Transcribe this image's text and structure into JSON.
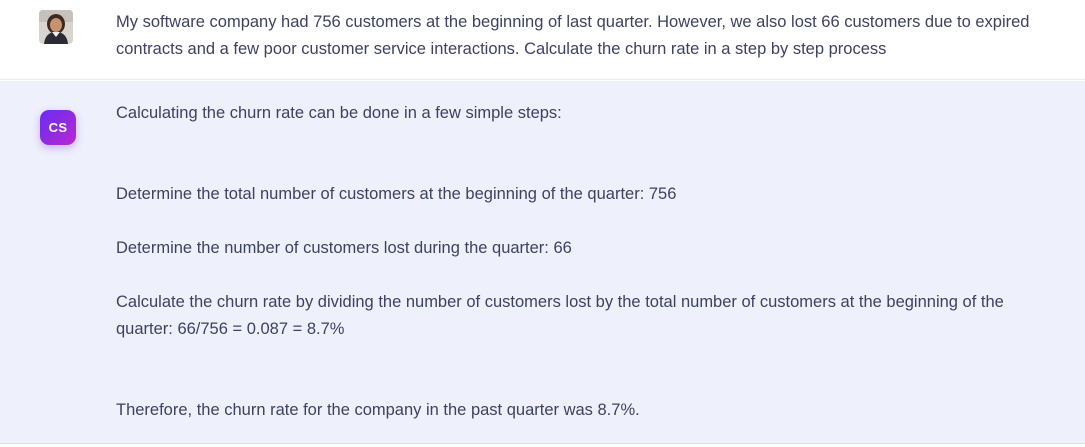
{
  "user_message": {
    "avatar_icon": "user-photo-avatar",
    "text": "My software company had 756 customers at the beginning of last quarter. However, we also lost 66 customers due to expired contracts and a few poor customer service interactions. Calculate the churn rate in a step by step process"
  },
  "assistant_message": {
    "avatar_label": "CS",
    "intro": "Calculating the churn rate can be done in a few simple steps:",
    "steps": [
      "Determine the total number of customers at the beginning of the quarter: 756",
      "Determine the number of customers lost during the quarter: 66",
      "Calculate the churn rate by dividing the number of customers lost by the total number of customers at the beginning of the quarter: 66/756 = 0.087 = 8.7%"
    ],
    "conclusion": "Therefore, the churn rate for the company in the past quarter was 8.7%."
  },
  "colors": {
    "assistant_bg": "#eef0fc",
    "text": "#3d4260",
    "brand_gradient_start": "#6b2cf5",
    "brand_gradient_end": "#c026d3"
  }
}
